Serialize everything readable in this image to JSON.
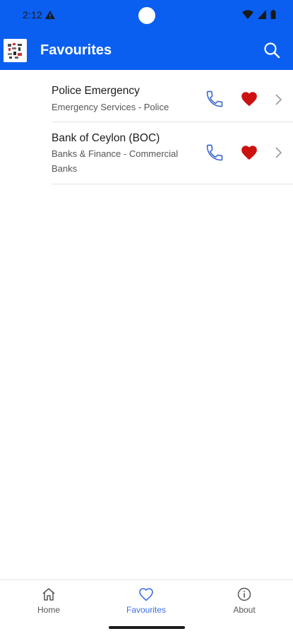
{
  "status_bar": {
    "time": "2:12"
  },
  "app_bar": {
    "title": "Favourites"
  },
  "favourites": [
    {
      "name": "Police Emergency",
      "category": "Emergency Services - Police"
    },
    {
      "name": "Bank of Ceylon (BOC)",
      "category": "Banks & Finance - Commercial Banks"
    }
  ],
  "bottom_nav": {
    "items": [
      {
        "label": "Home",
        "icon": "home-icon"
      },
      {
        "label": "Favourites",
        "icon": "heart-outline-icon"
      },
      {
        "label": "About",
        "icon": "info-icon"
      }
    ],
    "active": "Favourites"
  },
  "colors": {
    "primary": "#0a5ff0",
    "favorite": "#cc1111",
    "call": "#3e69cf",
    "nav_active": "#3b6ee6"
  }
}
